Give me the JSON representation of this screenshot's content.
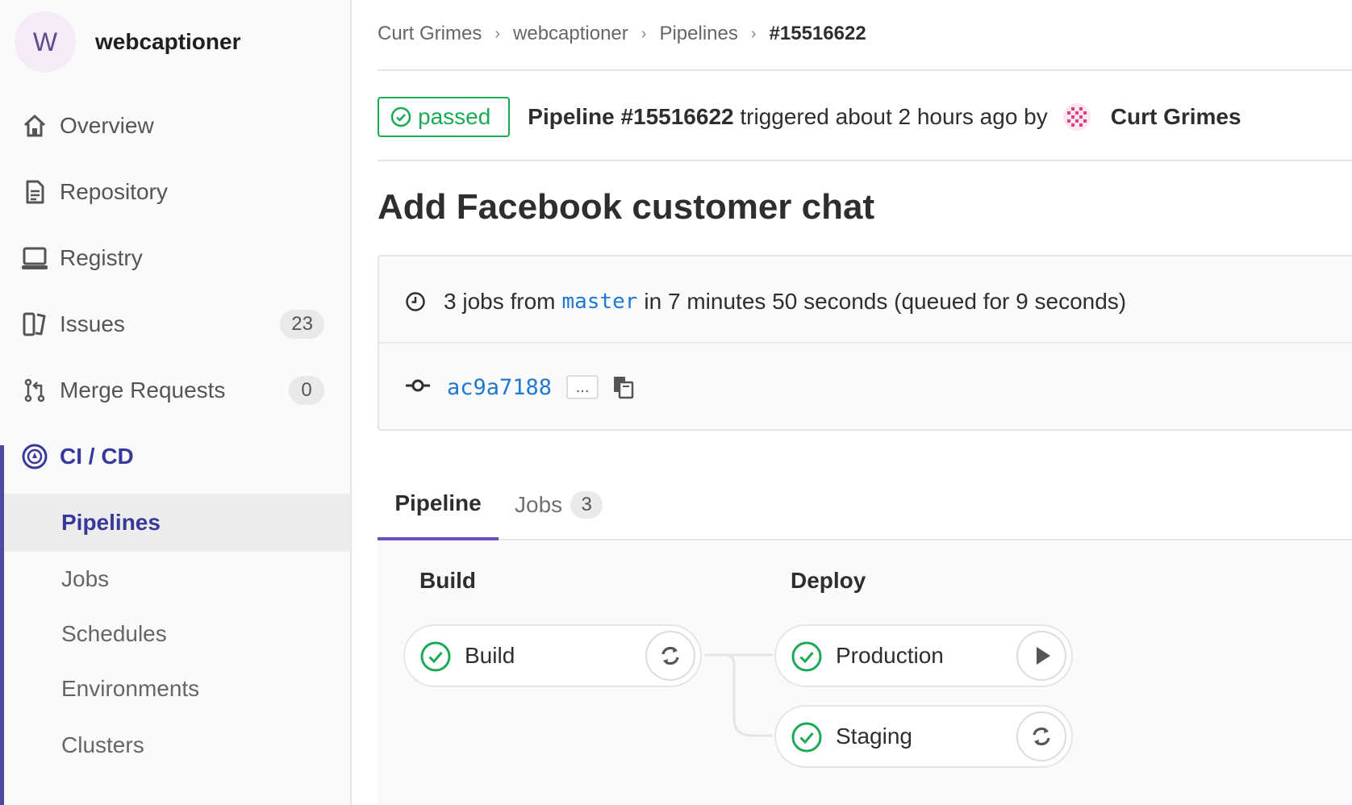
{
  "project": {
    "avatar_letter": "W",
    "name": "webcaptioner"
  },
  "sidebar": {
    "items": [
      {
        "label": "Overview",
        "icon": "home-icon"
      },
      {
        "label": "Repository",
        "icon": "document-icon"
      },
      {
        "label": "Registry",
        "icon": "laptop-icon"
      },
      {
        "label": "Issues",
        "icon": "issues-icon",
        "badge": "23"
      },
      {
        "label": "Merge Requests",
        "icon": "merge-request-icon",
        "badge": "0"
      },
      {
        "label": "CI / CD",
        "icon": "rocket-icon",
        "active": true
      }
    ],
    "cicd_subitems": [
      {
        "label": "Pipelines",
        "active": true
      },
      {
        "label": "Jobs"
      },
      {
        "label": "Schedules"
      },
      {
        "label": "Environments"
      },
      {
        "label": "Clusters"
      }
    ]
  },
  "breadcrumb": [
    "Curt Grimes",
    "webcaptioner",
    "Pipelines",
    "#15516622"
  ],
  "pipeline": {
    "status": "passed",
    "title_bold": "Pipeline #15516622",
    "title_rest": " triggered about 2 hours ago by",
    "user": "Curt Grimes",
    "commit_title": "Add Facebook customer chat",
    "jobs_prefix": "3 jobs from",
    "branch": "master",
    "jobs_suffix": "in 7 minutes 50 seconds (queued for 9 seconds)",
    "sha": "ac9a7188",
    "ellipsis": "..."
  },
  "tabs": [
    {
      "label": "Pipeline",
      "active": true
    },
    {
      "label": "Jobs",
      "count": "3"
    }
  ],
  "stages": [
    {
      "title": "Build",
      "jobs": [
        {
          "name": "Build",
          "status": "success",
          "action": "retry-icon"
        }
      ]
    },
    {
      "title": "Deploy",
      "jobs": [
        {
          "name": "Production",
          "status": "success",
          "action": "play-icon"
        },
        {
          "name": "Staging",
          "status": "success",
          "action": "retry-icon"
        }
      ]
    }
  ],
  "colors": {
    "success": "#1aaa55",
    "accent": "#38389a",
    "link": "#1f78d1",
    "tab_underline": "#6b4fbb"
  }
}
